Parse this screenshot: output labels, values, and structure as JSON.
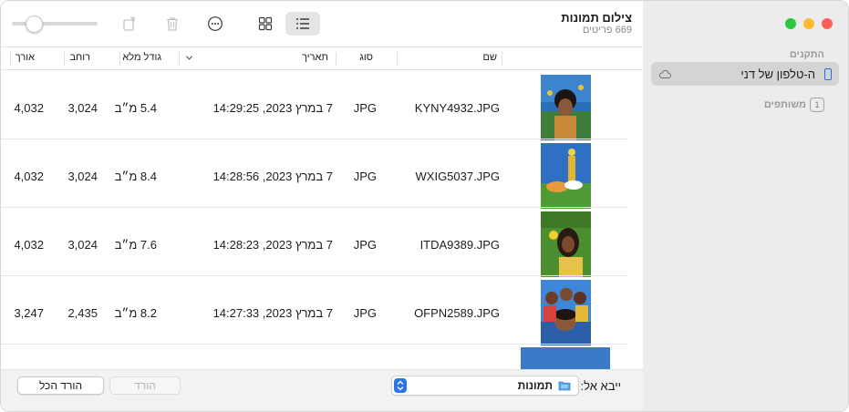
{
  "window": {
    "title": "צילום תמונות",
    "subtitle": "669 פריטים"
  },
  "traffic_lights": {
    "close": "#fe5f57",
    "minimize": "#febc2e",
    "zoom": "#28c840"
  },
  "sidebar": {
    "devices_heading": "התקנים",
    "device_name": "ה-טלפון של דני",
    "shared_heading": "משותפים",
    "shared_badge": "1"
  },
  "toolbar": {
    "slider_value": 0.26,
    "icons": [
      "rotate-icon",
      "trash-icon",
      "more-icon",
      "grid-view-icon",
      "list-view-icon"
    ]
  },
  "table": {
    "columns": {
      "name": "שם",
      "kind": "סוג",
      "date": "תאריך",
      "size": "גודל מלא",
      "width": "רוחב",
      "height": "אורך"
    },
    "rows": [
      {
        "name": "KYNY4932.JPG",
        "kind": "JPG",
        "date": "7 במרץ 2023, 14:29:25",
        "size": "5.4 מ״ב",
        "width": "3,024",
        "height": "4,032"
      },
      {
        "name": "WXIG5037.JPG",
        "kind": "JPG",
        "date": "7 במרץ 2023, 14:28:56",
        "size": "8.4 מ״ב",
        "width": "3,024",
        "height": "4,032"
      },
      {
        "name": "ITDA9389.JPG",
        "kind": "JPG",
        "date": "7 במרץ 2023, 14:28:23",
        "size": "7.6 מ״ב",
        "width": "3,024",
        "height": "4,032"
      },
      {
        "name": "OFPN2589.JPG",
        "kind": "JPG",
        "date": "7 במרץ 2023, 14:27:33",
        "size": "8.2 מ״ב",
        "width": "2,435",
        "height": "3,247"
      }
    ]
  },
  "footer": {
    "import_label": "ייבא אל:",
    "import_destination": "תמונות",
    "download_label": "הורד",
    "download_all_label": "הורד הכל"
  },
  "colors": {
    "accent": "#2a76e8",
    "sidebar_bg": "#ececec"
  }
}
